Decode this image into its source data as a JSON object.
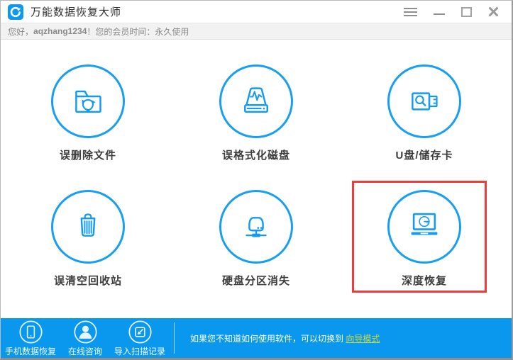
{
  "window": {
    "title": "万能数据恢复大师",
    "app_icon": "refresh-arrow-logo",
    "controls": [
      {
        "name": "menu"
      },
      {
        "name": "minimize"
      },
      {
        "name": "maximize"
      },
      {
        "name": "close"
      }
    ]
  },
  "greeting": {
    "prefix": "您好，",
    "username": "aqzhang1234",
    "suffix": "！您的会员时间：永久使用"
  },
  "recovery_modes": [
    {
      "id": "deleted-files",
      "label": "误删除文件",
      "icon": "folder-recycle-icon",
      "highlighted": false
    },
    {
      "id": "formatted-disk",
      "label": "误格式化磁盘",
      "icon": "disk-waveform-icon",
      "highlighted": false
    },
    {
      "id": "usb-storage",
      "label": "U盘/储存卡",
      "icon": "usb-search-icon",
      "highlighted": false
    },
    {
      "id": "recycle-bin",
      "label": "误清空回收站",
      "icon": "trash-icon",
      "highlighted": false
    },
    {
      "id": "lost-partition",
      "label": "硬盘分区消失",
      "icon": "harddisk-network-icon",
      "highlighted": false
    },
    {
      "id": "deep-recovery",
      "label": "深度恢复",
      "icon": "laptop-clock-icon",
      "highlighted": true
    }
  ],
  "footer": {
    "actions": [
      {
        "label": "手机数据恢复",
        "icon": "phone-icon"
      },
      {
        "label": "在线咨询",
        "icon": "person-icon"
      },
      {
        "label": "导入扫描记录",
        "icon": "import-icon"
      }
    ],
    "hint_text": "如果您不知道如何使用软件，可以切换到 ",
    "hint_link": "向导模式"
  },
  "colors": {
    "primary_blue": "#0A98EF",
    "icon_blue": "#149BF1",
    "highlight_red": "#EE3B3B",
    "link_green": "#C9DA3F",
    "member_bar_bg": "#F2F2F2"
  }
}
